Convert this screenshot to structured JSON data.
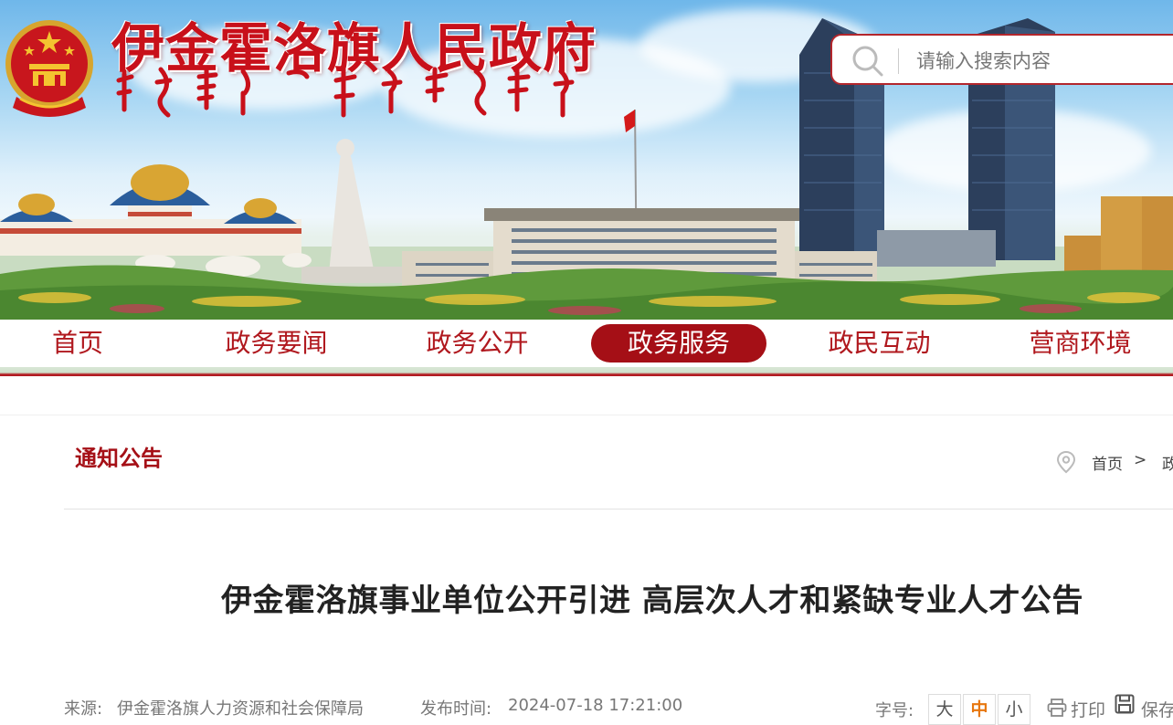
{
  "header": {
    "site_title": "伊金霍洛旗人民政府",
    "search": {
      "placeholder": "请输入搜索内容"
    }
  },
  "nav": {
    "items": [
      {
        "label": "首页",
        "active": false
      },
      {
        "label": "政务要闻",
        "active": false
      },
      {
        "label": "政务公开",
        "active": false
      },
      {
        "label": "政务服务",
        "active": true
      },
      {
        "label": "政民互动",
        "active": false
      },
      {
        "label": "营商环境",
        "active": false
      }
    ]
  },
  "section": {
    "title": "通知公告"
  },
  "breadcrumb": {
    "items": [
      "首页",
      "政"
    ],
    "separator": ">"
  },
  "article": {
    "title": "伊金霍洛旗事业单位公开引进 高层次人才和紧缺专业人才公告",
    "source_label": "来源:",
    "source": "伊金霍洛旗人力资源和社会保障局",
    "published_label": "发布时间:",
    "published": "2024-07-18 17:21:00"
  },
  "tools": {
    "font_size_label": "字号:",
    "font_sizes": [
      "大",
      "中",
      "小"
    ],
    "font_size_selected": "中",
    "print_label": "打印",
    "save_label": "保存"
  },
  "colors": {
    "brand_red": "#a50f16",
    "title_red": "#c8101a",
    "accent_orange": "#e7770f"
  },
  "icons": [
    "national-emblem-icon",
    "search-icon",
    "location-pin-icon",
    "printer-icon",
    "save-icon"
  ]
}
